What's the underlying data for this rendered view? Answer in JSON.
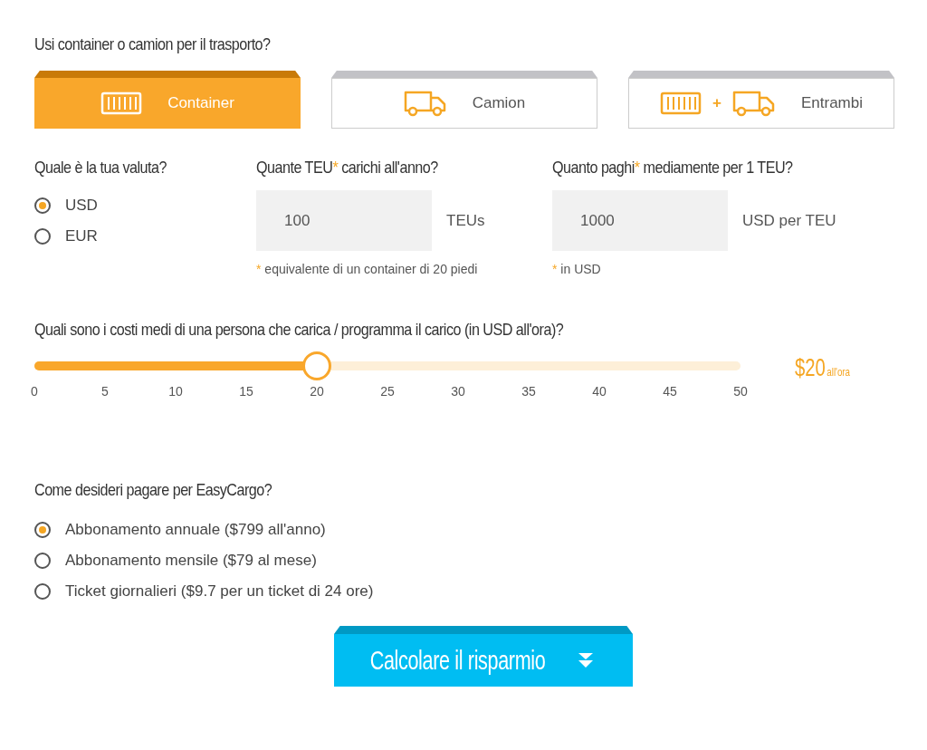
{
  "transport": {
    "question": "Usi container o camion per il trasporto?",
    "tabs": [
      {
        "label": "Container",
        "kind": "container",
        "selected": true
      },
      {
        "label": "Camion",
        "kind": "truck",
        "selected": false
      },
      {
        "label": "Entrambi",
        "kind": "both",
        "plus": "+",
        "selected": false
      }
    ]
  },
  "currency": {
    "question": "Quale è la tua valuta?",
    "options": [
      {
        "label": "USD",
        "selected": true
      },
      {
        "label": "EUR",
        "selected": false
      }
    ]
  },
  "teu": {
    "question_start": "Quante TEU",
    "asterisk": "*",
    "question_end": " carichi all'anno?",
    "value": "100",
    "unit": "TEUs",
    "note_mark": "*",
    "note": " equivalente di un container di 20 piedi"
  },
  "price": {
    "question_start": "Quanto paghi",
    "asterisk": "*",
    "question_end": " mediamente per 1 TEU?",
    "value": "1000",
    "unit": "USD per TEU",
    "note_mark": "*",
    "note": " in USD"
  },
  "cost": {
    "question": "Quali sono i costi medi di una persona che carica / programma il carico (in USD all'ora)?",
    "level": 0.4,
    "ticks": [
      "0",
      "5",
      "10",
      "15",
      "20",
      "25",
      "30",
      "35",
      "40",
      "45",
      "50"
    ],
    "reading": "$20",
    "reading_unit": "all'ora"
  },
  "payment": {
    "question": "Come desideri pagare per EasyCargo?",
    "options": [
      {
        "label": "Abbonamento annuale ($799 all'anno)",
        "selected": true
      },
      {
        "label": "Abbonamento mensile ($79 al mese)",
        "selected": false
      },
      {
        "label": "Ticket giornalieri ($9.7 per un ticket di 24 ore)",
        "selected": false
      }
    ]
  },
  "submit": {
    "label": "Calcolare il risparmio"
  }
}
